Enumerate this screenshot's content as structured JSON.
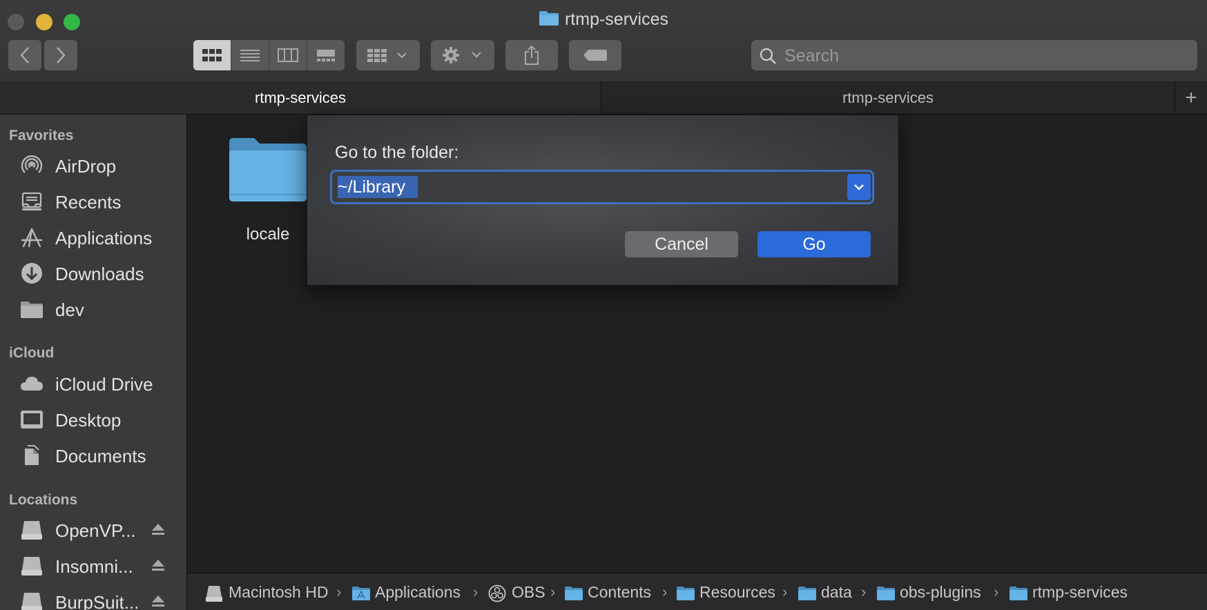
{
  "window": {
    "title": "rtmp-services"
  },
  "toolbar": {
    "back_icon": "chevron-left-icon",
    "forward_icon": "chevron-right-icon",
    "view_modes": [
      "icon-view",
      "list-view",
      "column-view",
      "gallery-view"
    ],
    "selected_view": "icon-view",
    "search_placeholder": "Search"
  },
  "tabs": [
    {
      "label": "rtmp-services",
      "active": true
    },
    {
      "label": "rtmp-services",
      "active": false
    }
  ],
  "tab_add_label": "+",
  "sidebar": {
    "sections": [
      {
        "title": "Favorites",
        "items": [
          {
            "label": "AirDrop",
            "icon": "airdrop-icon"
          },
          {
            "label": "Recents",
            "icon": "recents-icon"
          },
          {
            "label": "Applications",
            "icon": "applications-icon"
          },
          {
            "label": "Downloads",
            "icon": "downloads-icon"
          },
          {
            "label": "dev",
            "icon": "folder-icon"
          }
        ]
      },
      {
        "title": "iCloud",
        "items": [
          {
            "label": "iCloud Drive",
            "icon": "cloud-icon"
          },
          {
            "label": "Desktop",
            "icon": "desktop-icon"
          },
          {
            "label": "Documents",
            "icon": "documents-icon"
          }
        ]
      },
      {
        "title": "Locations",
        "items": [
          {
            "label": "OpenVP...",
            "icon": "disk-icon"
          },
          {
            "label": "Insomni...",
            "icon": "disk-icon"
          },
          {
            "label": "BurpSuit...",
            "icon": "disk-icon"
          }
        ]
      }
    ]
  },
  "content": {
    "items": [
      {
        "name": "locale",
        "icon": "folder-icon"
      }
    ]
  },
  "dialog": {
    "label": "Go to the folder:",
    "path_value": "~/Library",
    "cancel_label": "Cancel",
    "go_label": "Go"
  },
  "pathbar": {
    "crumbs": [
      "Macintosh HD",
      "Applications",
      "OBS",
      "Contents",
      "Resources",
      "data",
      "obs-plugins",
      "rtmp-services"
    ]
  },
  "colors": {
    "accent": "#2a6ad9",
    "folder": "#5aa9dc",
    "sidebar_bg": "#3a3a3c"
  }
}
